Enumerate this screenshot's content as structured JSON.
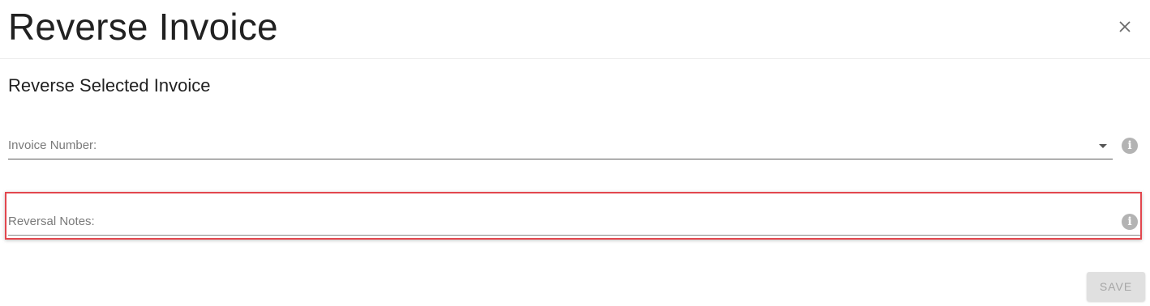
{
  "dialog": {
    "title": "Reverse Invoice",
    "subtitle": "Reverse Selected Invoice"
  },
  "fields": {
    "invoice_number": {
      "label": "Invoice Number:",
      "value": "",
      "icon": "info-icon"
    },
    "reversal_notes": {
      "label": "Reversal Notes:",
      "value": "",
      "icon": "info-icon"
    }
  },
  "actions": {
    "save_label": "SAVE",
    "close_icon": "close-icon"
  },
  "colors": {
    "highlight": "#e2474e",
    "label": "#7a7a7a",
    "button_bg": "#e0e0e0",
    "button_text": "#a6a6a6"
  }
}
